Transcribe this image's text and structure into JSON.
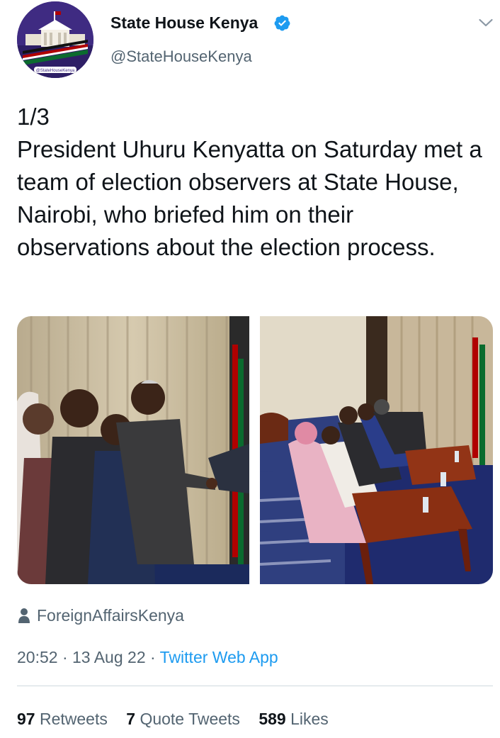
{
  "account": {
    "display_name": "State House Kenya",
    "handle": "@StateHouseKenya",
    "verified": true,
    "avatar_caption": "@StateHouseKenya"
  },
  "tweet": {
    "text": "1/3\nPresident Uhuru Kenyatta on Saturday met a team of election observers at State House, Nairobi, who briefed him on their observations about the election process.",
    "tagged_user": "ForeignAffairsKenya",
    "time": "20:52",
    "date": "13 Aug 22",
    "separator": "·",
    "source": "Twitter Web App"
  },
  "stats": {
    "retweets_count": "97",
    "retweets_label": "Retweets",
    "quote_count": "7",
    "quote_label": "Quote Tweets",
    "likes_count": "589",
    "likes_label": "Likes"
  },
  "icons": {
    "verified": "verified-badge-icon",
    "caret": "chevron-down-icon",
    "tag": "person-icon"
  },
  "colors": {
    "link": "#1d9bf0",
    "secondary_text": "#536471",
    "primary_text": "#0f1419"
  }
}
